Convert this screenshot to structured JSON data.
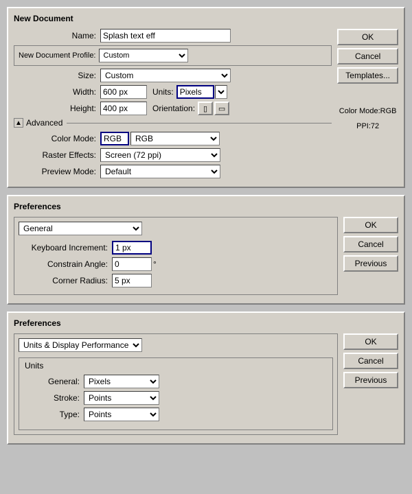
{
  "dialog1": {
    "title": "New Document",
    "name_label": "Name:",
    "name_value": "Splash text eff",
    "profile_label": "New Document Profile:",
    "profile_value": "Custom",
    "size_label": "Size:",
    "size_value": "Custom",
    "width_label": "Width:",
    "width_value": "600 px",
    "units_label": "Units:",
    "units_value": "Pixels",
    "height_label": "Height:",
    "height_value": "400 px",
    "orientation_label": "Orientation:",
    "advanced_label": "Advanced",
    "color_mode_label": "Color Mode:",
    "color_mode_value": "RGB",
    "raster_label": "Raster Effects:",
    "raster_value": "Screen (72 ppi)",
    "preview_label": "Preview Mode:",
    "preview_value": "Default",
    "color_info": "Color Mode:RGB",
    "ppi_info": "PPI:72",
    "ok_label": "OK",
    "cancel_label": "Cancel",
    "templates_label": "Templates..."
  },
  "dialog2": {
    "title": "Preferences",
    "section_label": "General",
    "keyboard_label": "Keyboard Increment:",
    "keyboard_value": "1 px",
    "constrain_label": "Constrain Angle:",
    "constrain_value": "0",
    "corner_label": "Corner Radius:",
    "corner_value": "5 px",
    "ok_label": "OK",
    "cancel_label": "Cancel",
    "previous_label": "Previous"
  },
  "dialog3": {
    "title": "Preferences",
    "section_label": "Units & Display Performance",
    "units_group_label": "Units",
    "general_label": "General:",
    "general_value": "Pixels",
    "stroke_label": "Stroke:",
    "stroke_value": "Points",
    "type_label": "Type:",
    "type_value": "Points",
    "ok_label": "OK",
    "cancel_label": "Cancel",
    "previous_label": "Previous"
  }
}
